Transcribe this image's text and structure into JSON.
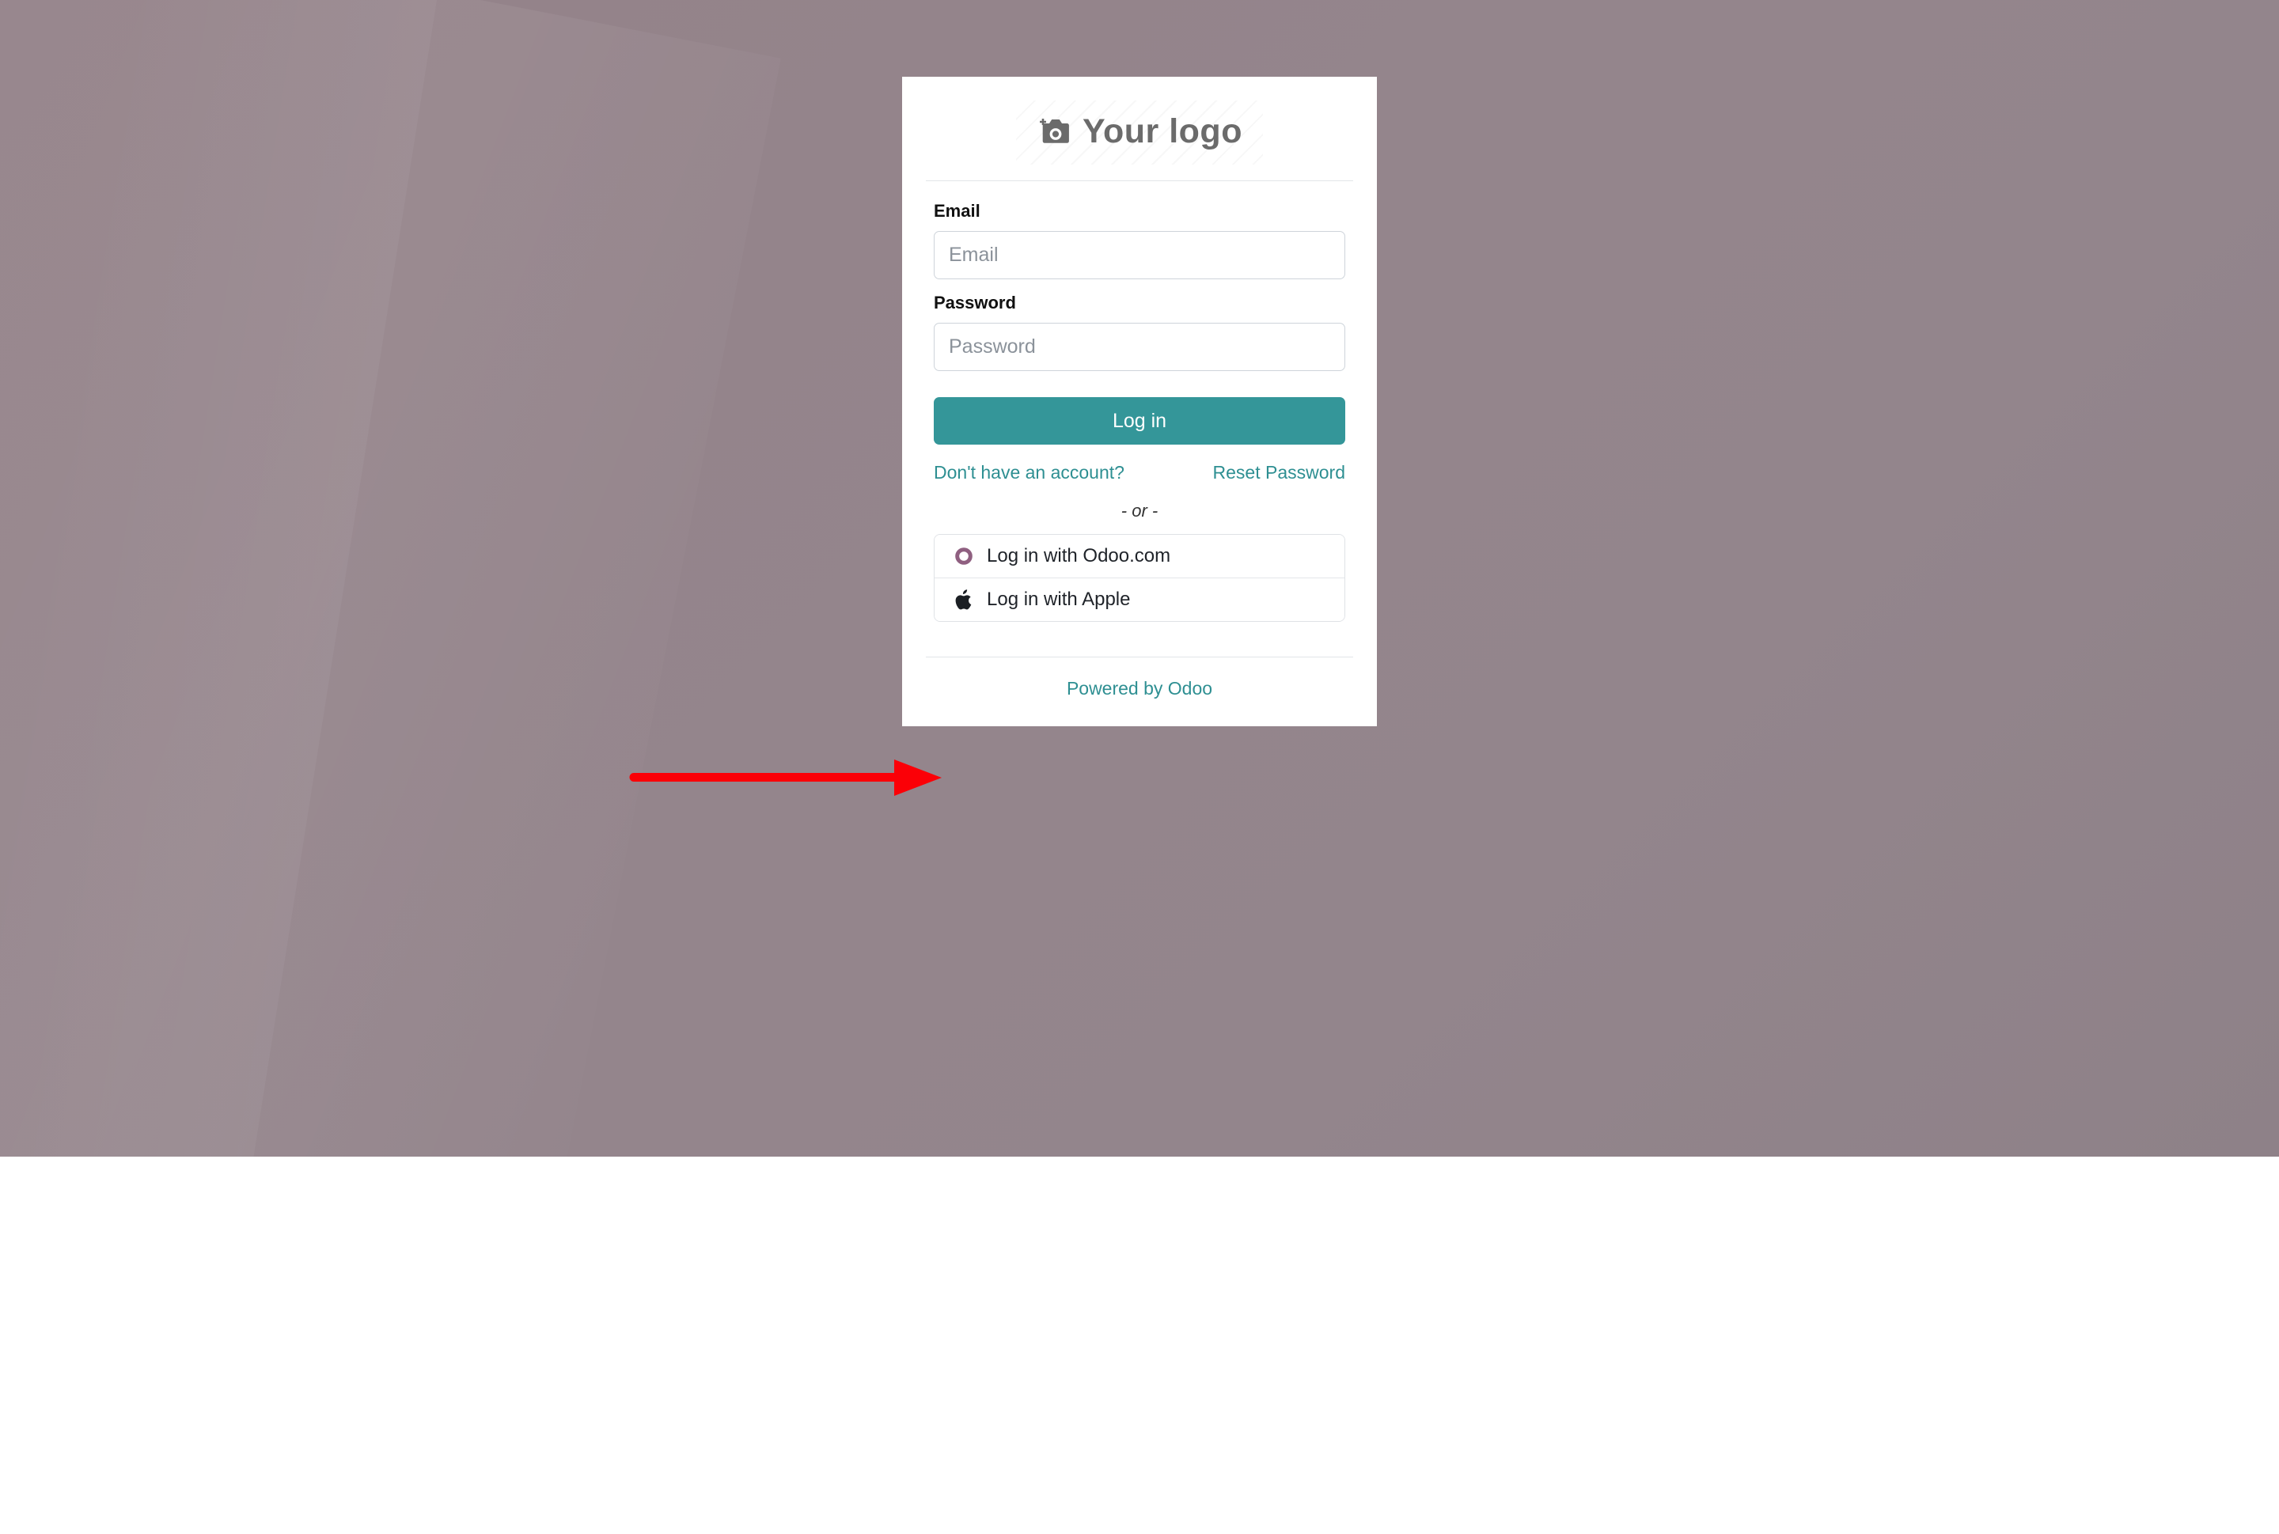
{
  "page": {
    "background_color": "#93858c",
    "card_background": "#ffffff"
  },
  "brand": {
    "logo_placeholder_text": "Your logo",
    "logo_icon": "camera-add-icon",
    "accent_color": "#349699",
    "odoo_icon_color": "#8f5f80"
  },
  "form": {
    "email": {
      "label": "Email",
      "placeholder": "Email",
      "value": ""
    },
    "password": {
      "label": "Password",
      "placeholder": "Password",
      "value": ""
    },
    "submit_label": "Log in"
  },
  "links": {
    "signup": "Don't have an account?",
    "reset_password": "Reset Password"
  },
  "separator": {
    "or_text": "- or -"
  },
  "oauth": {
    "providers": [
      {
        "label": "Log in with Odoo.com",
        "icon": "odoo-ring-icon"
      },
      {
        "label": "Log in with Apple",
        "icon": "apple-icon"
      }
    ]
  },
  "footer": {
    "powered_by": "Powered by Odoo"
  },
  "annotation": {
    "arrow_color": "#fb0007",
    "points_to": "Log in with Apple"
  }
}
